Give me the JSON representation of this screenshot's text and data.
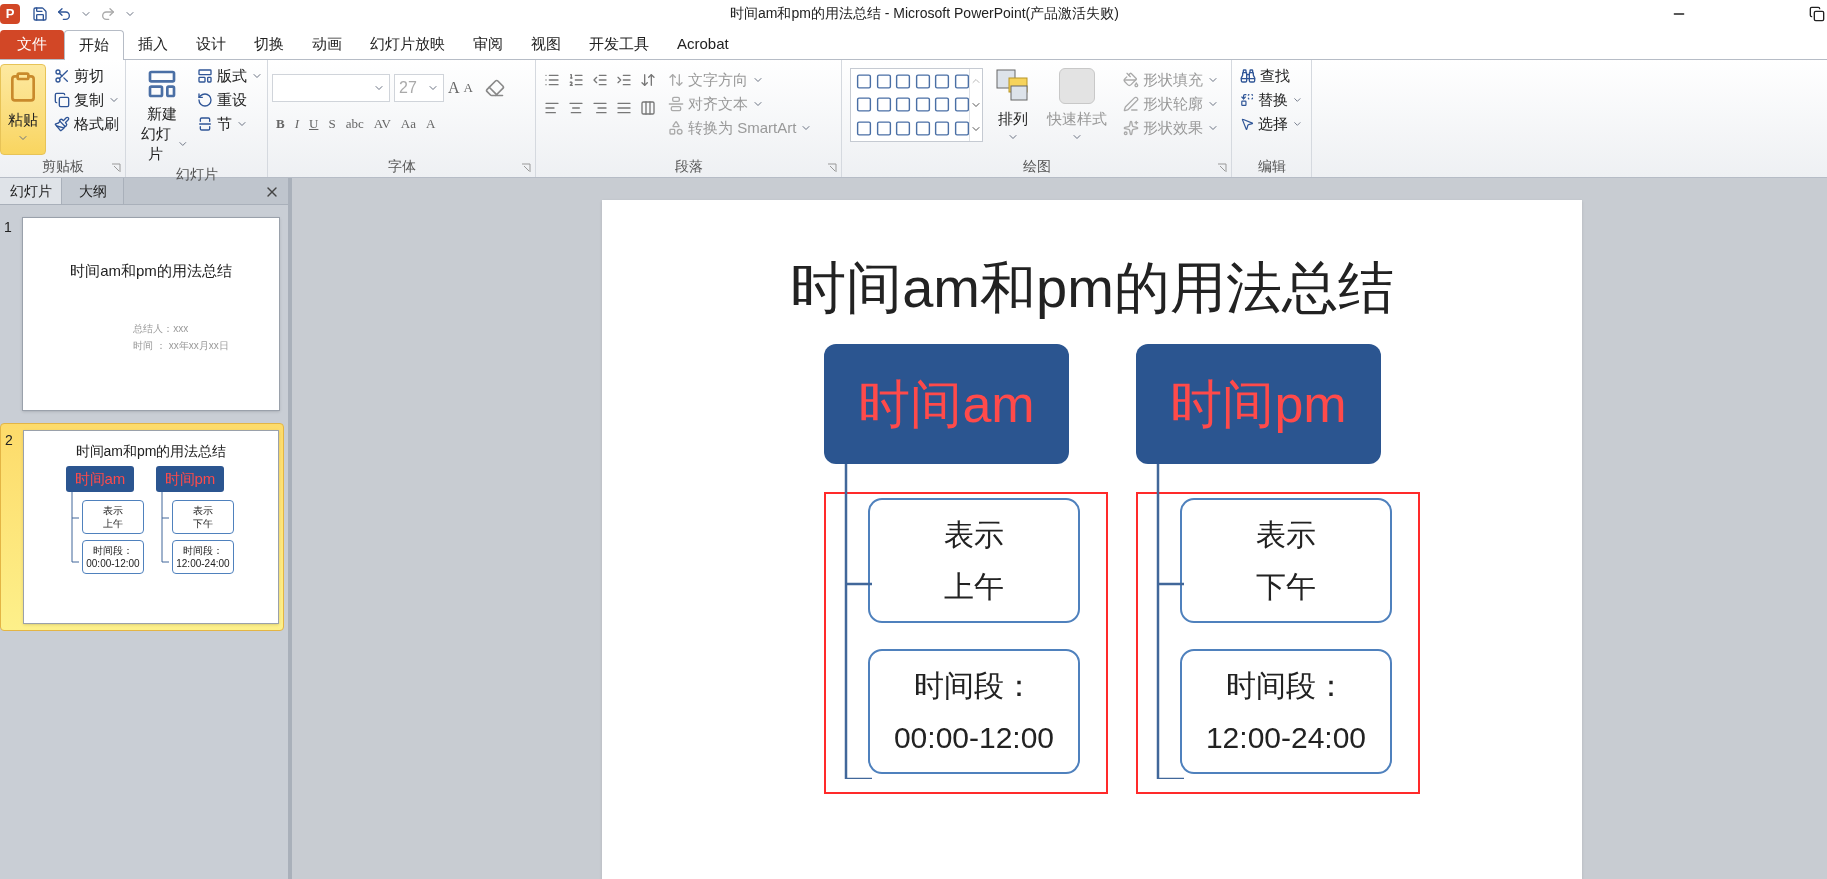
{
  "window": {
    "app_letter": "P",
    "title": "时间am和pm的用法总结  -  Microsoft PowerPoint(产品激活失败)"
  },
  "file_tab": "文件",
  "tabs": [
    {
      "label": "开始",
      "selected": true
    },
    {
      "label": "插入",
      "selected": false
    },
    {
      "label": "设计",
      "selected": false
    },
    {
      "label": "切换",
      "selected": false
    },
    {
      "label": "动画",
      "selected": false
    },
    {
      "label": "幻灯片放映",
      "selected": false
    },
    {
      "label": "审阅",
      "selected": false
    },
    {
      "label": "视图",
      "selected": false
    },
    {
      "label": "开发工具",
      "selected": false
    },
    {
      "label": "Acrobat",
      "selected": false
    }
  ],
  "ribbon": {
    "clipboard": {
      "label": "剪贴板",
      "paste": {
        "label": "粘贴",
        "highlighted": true
      },
      "items": [
        {
          "label": "剪切",
          "dropdown": false
        },
        {
          "label": "复制",
          "dropdown": true
        },
        {
          "label": "格式刷",
          "dropdown": false
        }
      ]
    },
    "slides": {
      "label": "幻灯片",
      "new_slide": [
        "新建",
        "幻灯片"
      ],
      "items": [
        {
          "label": "版式",
          "dropdown": true
        },
        {
          "label": "重设",
          "dropdown": false
        },
        {
          "label": "节",
          "dropdown": true
        }
      ]
    },
    "font": {
      "label": "字体",
      "font_size": "27",
      "size_buttons": [
        "A",
        "A"
      ],
      "format_buttons": [
        "B",
        "I",
        "U",
        "S",
        "abc",
        "AV",
        "Aa",
        "A"
      ]
    },
    "paragraph": {
      "label": "段落",
      "commands": [
        {
          "label": "文字方向",
          "disabled": true
        },
        {
          "label": "对齐文本",
          "disabled": true
        },
        {
          "label": "转换为 SmartArt",
          "disabled": true
        }
      ]
    },
    "drawing": {
      "label": "绘图",
      "arrange": "排列",
      "quick_styles": {
        "label": "快速样式",
        "disabled": true
      },
      "commands": [
        {
          "label": "形状填充",
          "disabled": true
        },
        {
          "label": "形状轮廓",
          "disabled": true
        },
        {
          "label": "形状效果",
          "disabled": true
        }
      ]
    },
    "editing": {
      "label": "编辑",
      "commands": [
        {
          "label": "查找",
          "dropdown": false
        },
        {
          "label": "替换",
          "dropdown": true
        },
        {
          "label": "选择",
          "dropdown": true
        }
      ]
    }
  },
  "panel": {
    "tabs": [
      {
        "label": "幻灯片",
        "selected": true
      },
      {
        "label": "大纲",
        "selected": false
      }
    ],
    "thumbnails": [
      {
        "number": "1",
        "selected": false,
        "kind": "title",
        "title": "时间am和pm的用法总结",
        "lines": [
          "总结人：xxx",
          "时间 ： xx年xx月xx日"
        ]
      },
      {
        "number": "2",
        "selected": true,
        "kind": "diagram",
        "title": "时间am和pm的用法总结",
        "columns": [
          {
            "header": "时间am",
            "items": [
              [
                "表示",
                "上午"
              ],
              [
                "时间段：",
                "00:00-12:00"
              ]
            ]
          },
          {
            "header": "时间pm",
            "items": [
              [
                "表示",
                "下午"
              ],
              [
                "时间段：",
                "12:00-24:00"
              ]
            ]
          }
        ]
      }
    ]
  },
  "slide": {
    "title": "时间am和pm的用法总结",
    "columns": [
      {
        "header": "时间am",
        "highlighted": true,
        "items": [
          [
            "表示",
            "上午"
          ],
          [
            "时间段：",
            "00:00-12:00"
          ]
        ]
      },
      {
        "header": "时间pm",
        "highlighted": true,
        "items": [
          [
            "表示",
            "下午"
          ],
          [
            "时间段：",
            "12:00-24:00"
          ]
        ]
      }
    ]
  }
}
